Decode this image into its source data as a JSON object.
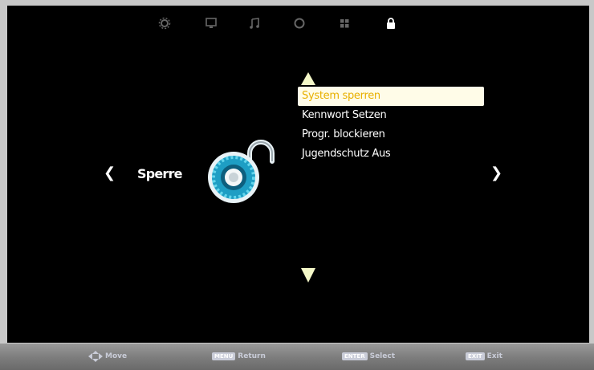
{
  "top_icons": [
    {
      "name": "settings-icon"
    },
    {
      "name": "picture-icon"
    },
    {
      "name": "sound-icon"
    },
    {
      "name": "timer-icon"
    },
    {
      "name": "apps-icon"
    },
    {
      "name": "lock-icon",
      "active": true
    }
  ],
  "category": {
    "label": "Sperre",
    "prev": "❮",
    "next": "❯"
  },
  "menu": {
    "items": [
      {
        "label": "System sperren",
        "selected": true
      },
      {
        "label": "Kennwort Setzen"
      },
      {
        "label": "Progr. blockieren"
      },
      {
        "label": "Jugendschutz Aus"
      }
    ]
  },
  "bottom_bar": {
    "move_label": "Move",
    "return_key": "MENU",
    "return_label": "Return",
    "select_key": "ENTER",
    "select_label": "Select",
    "exit_key": "EXIT",
    "exit_label": "Exit"
  },
  "colors": {
    "highlight_bg": "#fffce8",
    "highlight_text": "#e8b000",
    "background": "#000000",
    "bottom_bar": "#8a8a8a"
  }
}
